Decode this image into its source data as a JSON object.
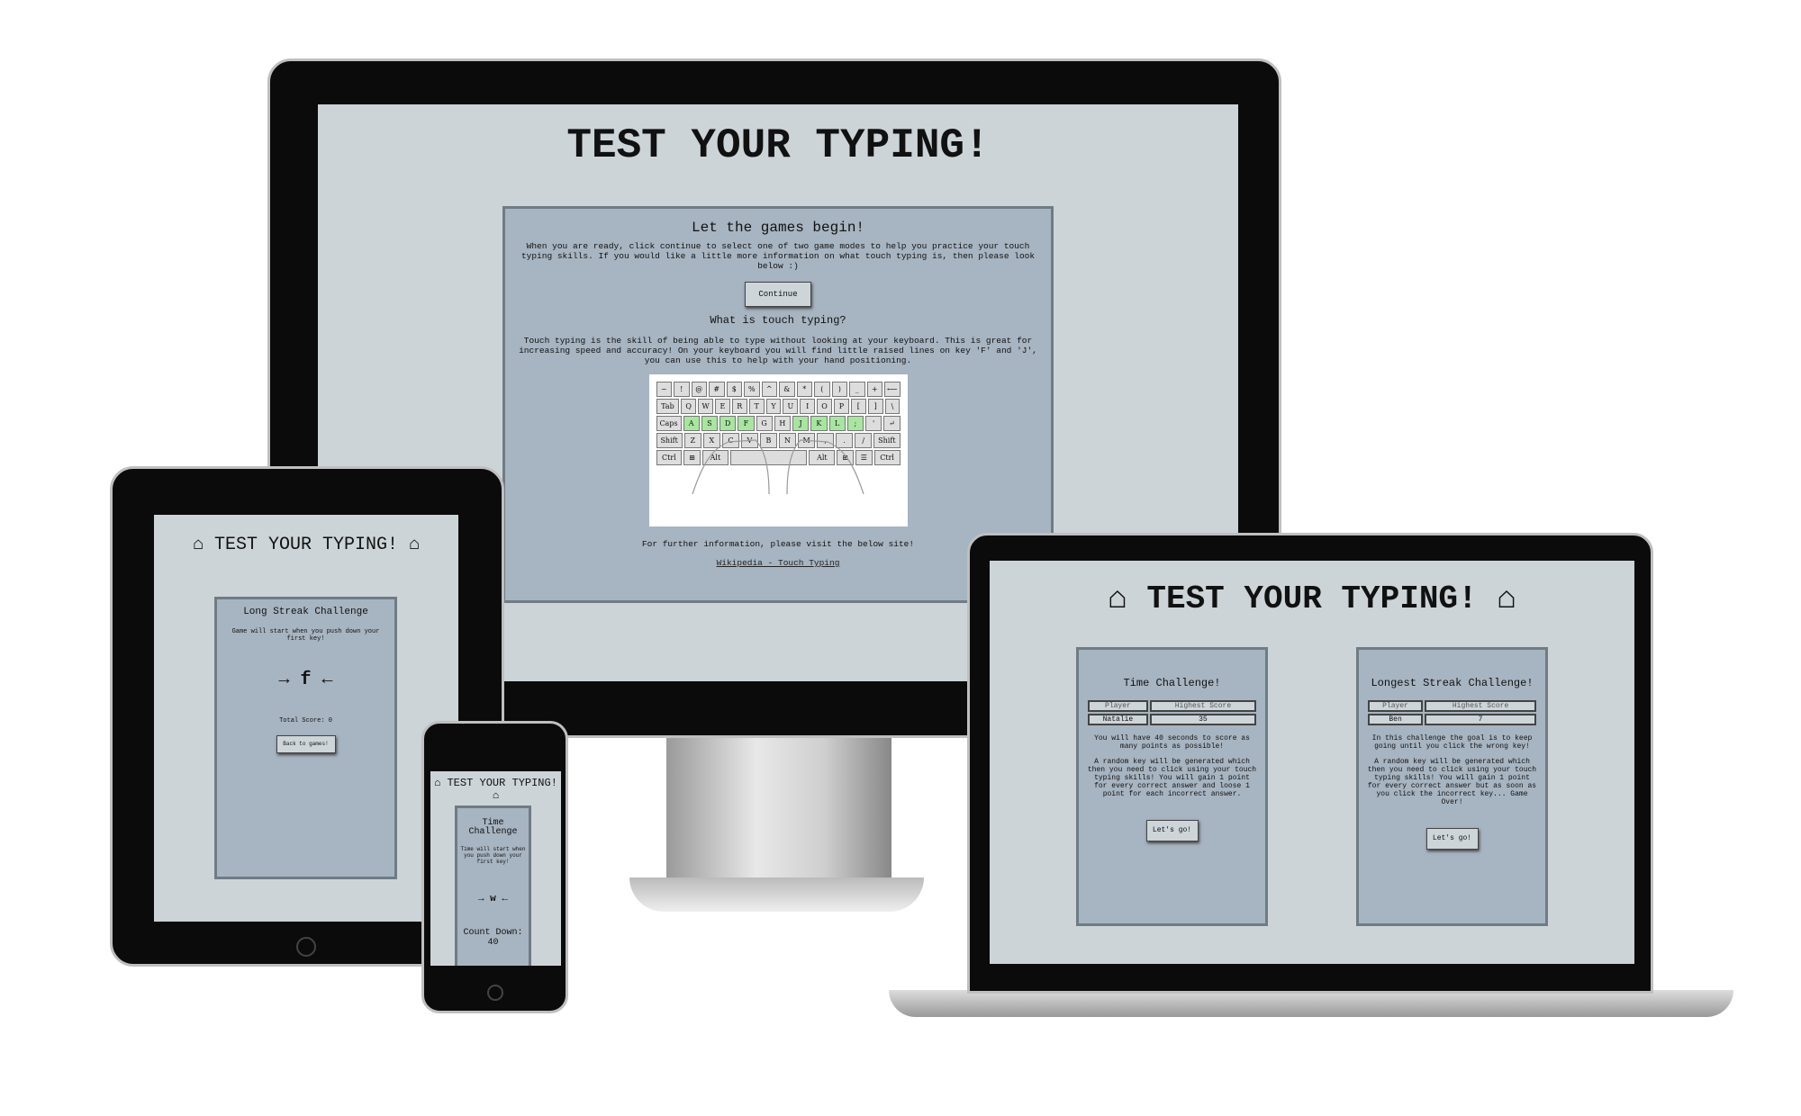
{
  "desktop": {
    "title": "TEST YOUR TYPING!",
    "heading": "Let the games begin!",
    "intro": "When you are ready, click continue to select one of two game modes to help you practice your touch typing skills. If you would like a little more information on what touch typing is, then please look below :)",
    "continue_label": "Continue",
    "subheading": "What is touch typing?",
    "explanation": "Touch typing is the skill of being able to type without looking at your keyboard. This is great for increasing speed and accuracy! On your keyboard you will find little raised lines on key 'F' and 'J', you can use this to help with your hand positioning.",
    "keyboard_rows": [
      [
        "~",
        "!",
        "@",
        "#",
        "$",
        "%",
        "^",
        "&",
        "*",
        "(",
        ")",
        "_",
        "+",
        "⟵"
      ],
      [
        "Tab",
        "Q",
        "W",
        "E",
        "R",
        "T",
        "Y",
        "U",
        "I",
        "O",
        "P",
        "[",
        "]",
        "\\"
      ],
      [
        "Caps Lock",
        "A",
        "S",
        "D",
        "F",
        "G",
        "H",
        "J",
        "K",
        "L",
        ";",
        "'",
        "↵"
      ],
      [
        "Shift",
        "Z",
        "X",
        "C",
        "V",
        "B",
        "N",
        "M",
        ",",
        ".",
        "/",
        "Shift"
      ],
      [
        "Ctrl",
        "⊞",
        "Alt",
        "",
        "Alt",
        "⊞",
        "☰",
        "Ctrl"
      ]
    ],
    "further_info": "For further information, please visit the below site!",
    "link_label": "Wikipedia - Touch Typing"
  },
  "laptop": {
    "title": "⌂ TEST YOUR TYPING! ⌂",
    "cards": [
      {
        "title": "Time Challenge!",
        "headers": [
          "Player",
          "Highest Score"
        ],
        "row": [
          "Natalie",
          "35"
        ],
        "p1": "You will have 40 seconds to score as many points as possible!",
        "p2": "A random key will be generated which then you need to click using your touch typing skills! You will gain 1 point for every correct answer and loose 1 point for each incorrect answer.",
        "button": "Let's go!"
      },
      {
        "title": "Longest Streak Challenge!",
        "headers": [
          "Player",
          "Highest Score"
        ],
        "row": [
          "Ben",
          "7"
        ],
        "p1": "In this challenge the goal is to keep going until you click the wrong key!",
        "p2": "A random key will be generated which then you need to click using your touch typing skills! You will gain 1 point for every correct answer but as soon as you click the incorrect key... Game Over!",
        "button": "Let's go!"
      }
    ]
  },
  "tablet": {
    "title": "⌂ TEST YOUR TYPING! ⌂",
    "card_title": "Long Streak Challenge",
    "instruction": "Game will start when you push down your first key!",
    "key": "→ f ←",
    "score": "Total Score: 0",
    "button": "Back to games!"
  },
  "phone": {
    "title": "⌂ TEST YOUR TYPING! ⌂",
    "card_title": "Time Challenge",
    "instruction": "Time will start when you push down your first key!",
    "key": "→ w ←",
    "countdown": "Count Down: 40"
  }
}
